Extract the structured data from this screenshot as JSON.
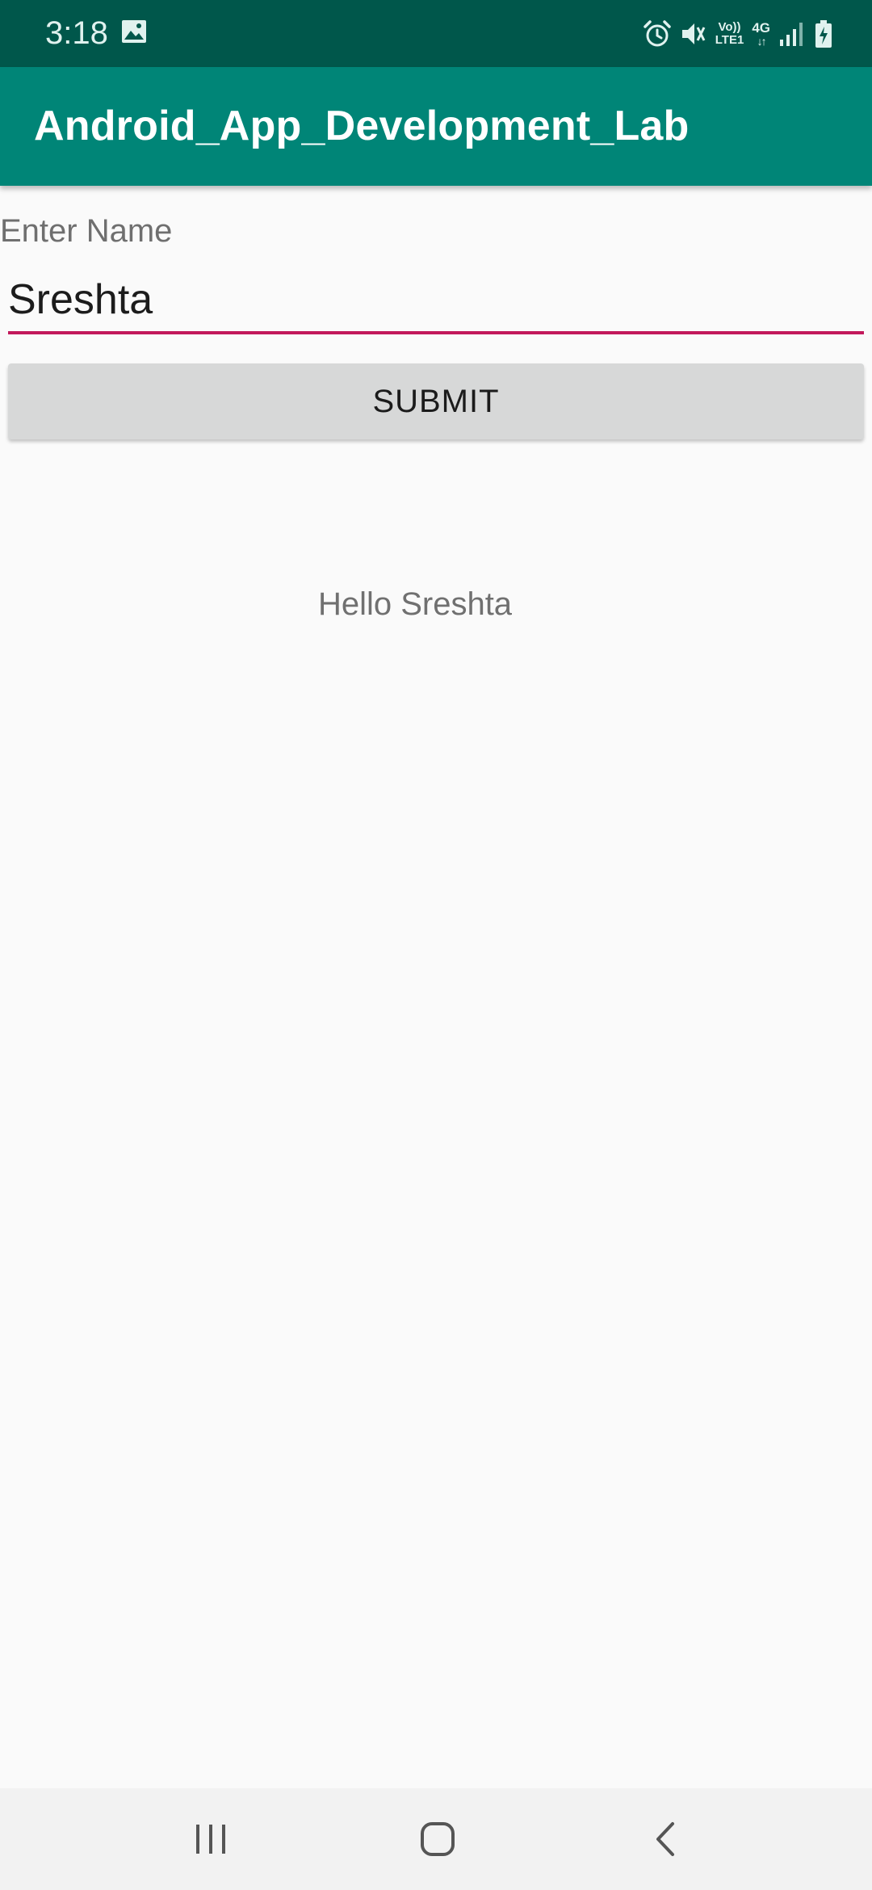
{
  "status_bar": {
    "time": "3:18",
    "network_volte": "Vo))",
    "network_lte": "LTE1",
    "network_type": "4G",
    "network_arrows": "↓↑"
  },
  "app_bar": {
    "title": "Android_App_Development_Lab"
  },
  "form": {
    "label": "Enter Name",
    "name_value": "Sreshta",
    "submit_label": "SUBMIT"
  },
  "output": {
    "greeting": "Hello Sreshta"
  },
  "colors": {
    "status_bar": "#00574b",
    "app_bar": "#008577",
    "accent": "#c2185b",
    "button": "#d7d8d8",
    "background": "#fafafa"
  },
  "icons": {
    "status": [
      "gallery-icon",
      "alarm-icon",
      "mute-icon",
      "signal-icon",
      "battery-charging-icon"
    ],
    "navigation": [
      "recents-icon",
      "home-icon",
      "back-icon"
    ]
  }
}
